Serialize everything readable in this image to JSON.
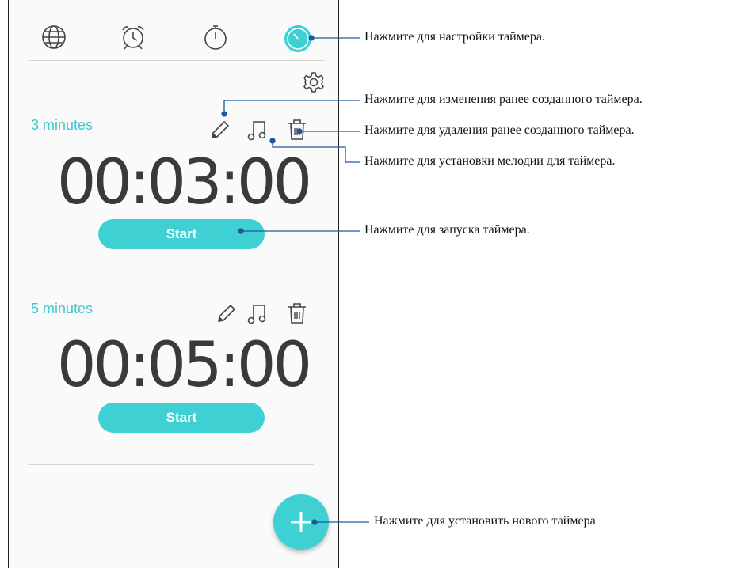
{
  "tabs": [
    {
      "name": "world-clock",
      "icon": "globe-icon"
    },
    {
      "name": "alarm",
      "icon": "alarm-clock-icon"
    },
    {
      "name": "stopwatch",
      "icon": "stopwatch-icon"
    },
    {
      "name": "timer",
      "icon": "timer-icon",
      "active": true
    }
  ],
  "settings_icon": "gear-icon",
  "timers": [
    {
      "label": "3 minutes",
      "time": "00:03:00",
      "start_label": "Start",
      "icons": [
        "pencil-icon",
        "music-note-icon",
        "trash-icon"
      ]
    },
    {
      "label": "5 minutes",
      "time": "00:05:00",
      "start_label": "Start",
      "icons": [
        "pencil-icon",
        "music-note-icon",
        "trash-icon"
      ]
    }
  ],
  "fab_icon": "plus-icon",
  "callouts": {
    "settings": "Нажмите для настройки таймера.",
    "edit": "Нажмите для изменения ранее созданного таймера.",
    "delete": "Нажмите для удаления ранее созданного таймера.",
    "ringtone": "Нажмите для установки мелодии для таймера.",
    "start": "Нажмите для запуска таймера.",
    "add": "Нажмите для установить нового таймера"
  },
  "colors": {
    "accent": "#3fd0d4",
    "label": "#3ec8cf",
    "callout_line": "#1a5a9a"
  }
}
